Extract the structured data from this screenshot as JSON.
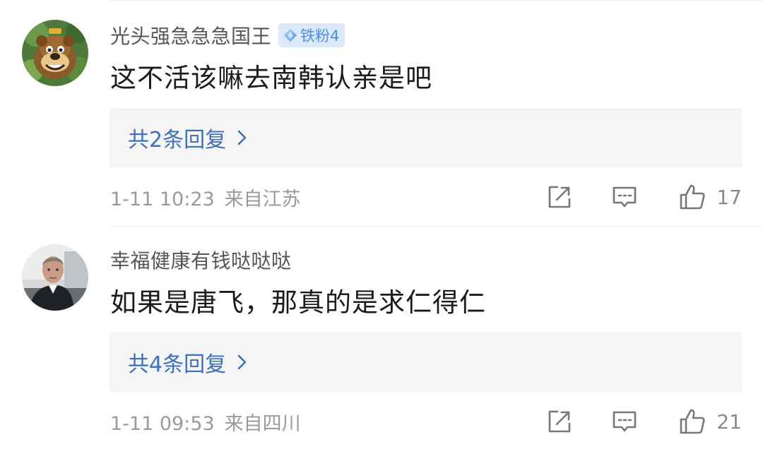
{
  "comments": [
    {
      "username": "光头强急急急国王",
      "fan_badge": "铁粉4",
      "text": "这不活该嘛去南韩认亲是吧",
      "reply_label": "共2条回复",
      "time": "1-11 10:23",
      "location": "来自江苏",
      "likes": "17",
      "avatar_icon": "cartoon-bear-avatar"
    },
    {
      "username": "幸福健康有钱哒哒哒",
      "text": "如果是唐飞，那真的是求仁得仁",
      "reply_label": "共4条回复",
      "time": "1-11 09:53",
      "location": "来自四川",
      "likes": "21",
      "avatar_icon": "man-portrait-avatar"
    }
  ],
  "icons": {
    "share": "share-icon",
    "comment": "comment-icon",
    "like": "thumbs-up-icon",
    "chevron": "chevron-right-icon",
    "badge": "diamond-icon"
  },
  "colors": {
    "link": "#3c6fbf",
    "badge_bg": "#dbe9fb",
    "badge_text": "#4b8fe8",
    "meta": "#9a9a9a",
    "reply_bg": "#f5f5f5"
  }
}
